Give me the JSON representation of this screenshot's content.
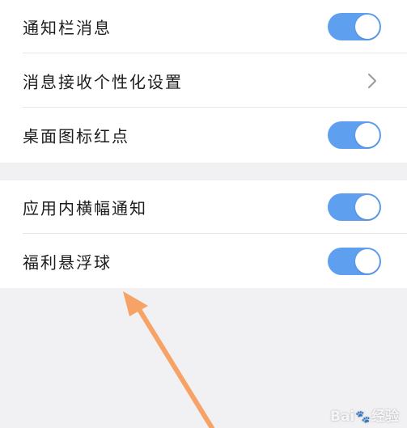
{
  "settings": {
    "group1": [
      {
        "label": "通知栏消息",
        "control": "toggle",
        "state": "on"
      },
      {
        "label": "消息接收个性化设置",
        "control": "chevron-right-icon"
      },
      {
        "label": "桌面图标红点",
        "control": "toggle",
        "state": "on"
      }
    ],
    "group2": [
      {
        "label": "应用内横幅通知",
        "control": "toggle",
        "state": "on"
      },
      {
        "label": "福利悬浮球",
        "control": "toggle",
        "state": "on"
      }
    ]
  },
  "annotation": {
    "arrow_color": "#f7a266"
  },
  "watermark": {
    "text_left": "Bai",
    "text_right": "经验"
  },
  "colors": {
    "toggle_on": "#5e9ff0",
    "page_background": "#f1f1f3",
    "card_background": "#ffffff"
  }
}
